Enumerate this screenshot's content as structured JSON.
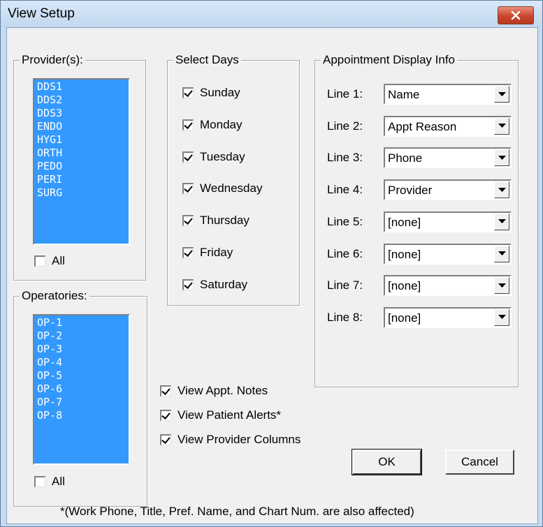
{
  "window": {
    "title": "View Setup"
  },
  "providers": {
    "label": "Provider(s):",
    "items": [
      "DDS1",
      "DDS2",
      "DDS3",
      "ENDO",
      "HYG1",
      "ORTH",
      "PEDO",
      "PERI",
      "SURG"
    ],
    "all_label": "All",
    "all_checked": false
  },
  "operatories": {
    "label": "Operatories:",
    "items": [
      "OP-1",
      "OP-2",
      "OP-3",
      "OP-4",
      "OP-5",
      "OP-6",
      "OP-7",
      "OP-8"
    ],
    "all_label": "All",
    "all_checked": false
  },
  "select_days": {
    "label": "Select Days",
    "days": [
      {
        "label": "Sunday",
        "checked": true
      },
      {
        "label": "Monday",
        "checked": true
      },
      {
        "label": "Tuesday",
        "checked": true
      },
      {
        "label": "Wednesday",
        "checked": true
      },
      {
        "label": "Thursday",
        "checked": true
      },
      {
        "label": "Friday",
        "checked": true
      },
      {
        "label": "Saturday",
        "checked": true
      }
    ]
  },
  "appointment_display": {
    "label": "Appointment Display Info",
    "lines": [
      {
        "label": "Line 1:",
        "value": "Name"
      },
      {
        "label": "Line 2:",
        "value": "Appt Reason"
      },
      {
        "label": "Line 3:",
        "value": "Phone"
      },
      {
        "label": "Line 4:",
        "value": "Provider"
      },
      {
        "label": "Line 5:",
        "value": "[none]"
      },
      {
        "label": "Line 6:",
        "value": "[none]"
      },
      {
        "label": "Line 7:",
        "value": "[none]"
      },
      {
        "label": "Line 8:",
        "value": "[none]"
      }
    ]
  },
  "options": [
    {
      "label": "View Appt. Notes",
      "checked": true
    },
    {
      "label": "View Patient Alerts*",
      "checked": true
    },
    {
      "label": "View Provider Columns",
      "checked": true
    }
  ],
  "buttons": {
    "ok": "OK",
    "cancel": "Cancel"
  },
  "footnote": "*(Work Phone, Title, Pref. Name, and Chart Num. are also affected)",
  "icons": {
    "close": "close-icon",
    "dropdown": "chevron-down-icon"
  },
  "colors": {
    "selection": "#3399ff",
    "close_button": "#c9452c"
  }
}
